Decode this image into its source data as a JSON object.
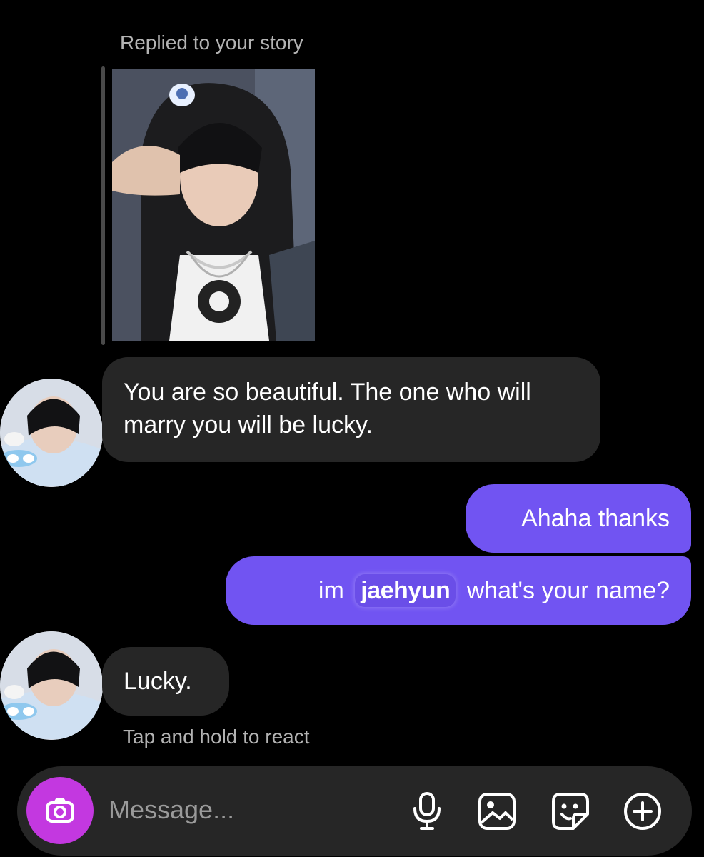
{
  "story": {
    "reply_label": "Replied to your story"
  },
  "messages": [
    {
      "from": "them",
      "text": "You are so beautiful. The one who will marry you will be lucky."
    },
    {
      "from": "me",
      "text": "Ahaha thanks"
    },
    {
      "from": "me",
      "prefix": "im",
      "name": "jaehyun",
      "suffix": "what's your name?"
    },
    {
      "from": "them",
      "text": "Lucky."
    }
  ],
  "hint": "Tap and hold to react",
  "composer": {
    "placeholder": "Message...",
    "icons": [
      "camera-icon",
      "microphone-icon",
      "gallery-icon",
      "sticker-icon",
      "plus-circle-icon"
    ]
  },
  "colors": {
    "background": "#000000",
    "incoming_bubble": "#262626",
    "outgoing_bubble": "#7154f2",
    "camera_button": "#c338e0",
    "secondary_text": "#b3b3b3"
  }
}
